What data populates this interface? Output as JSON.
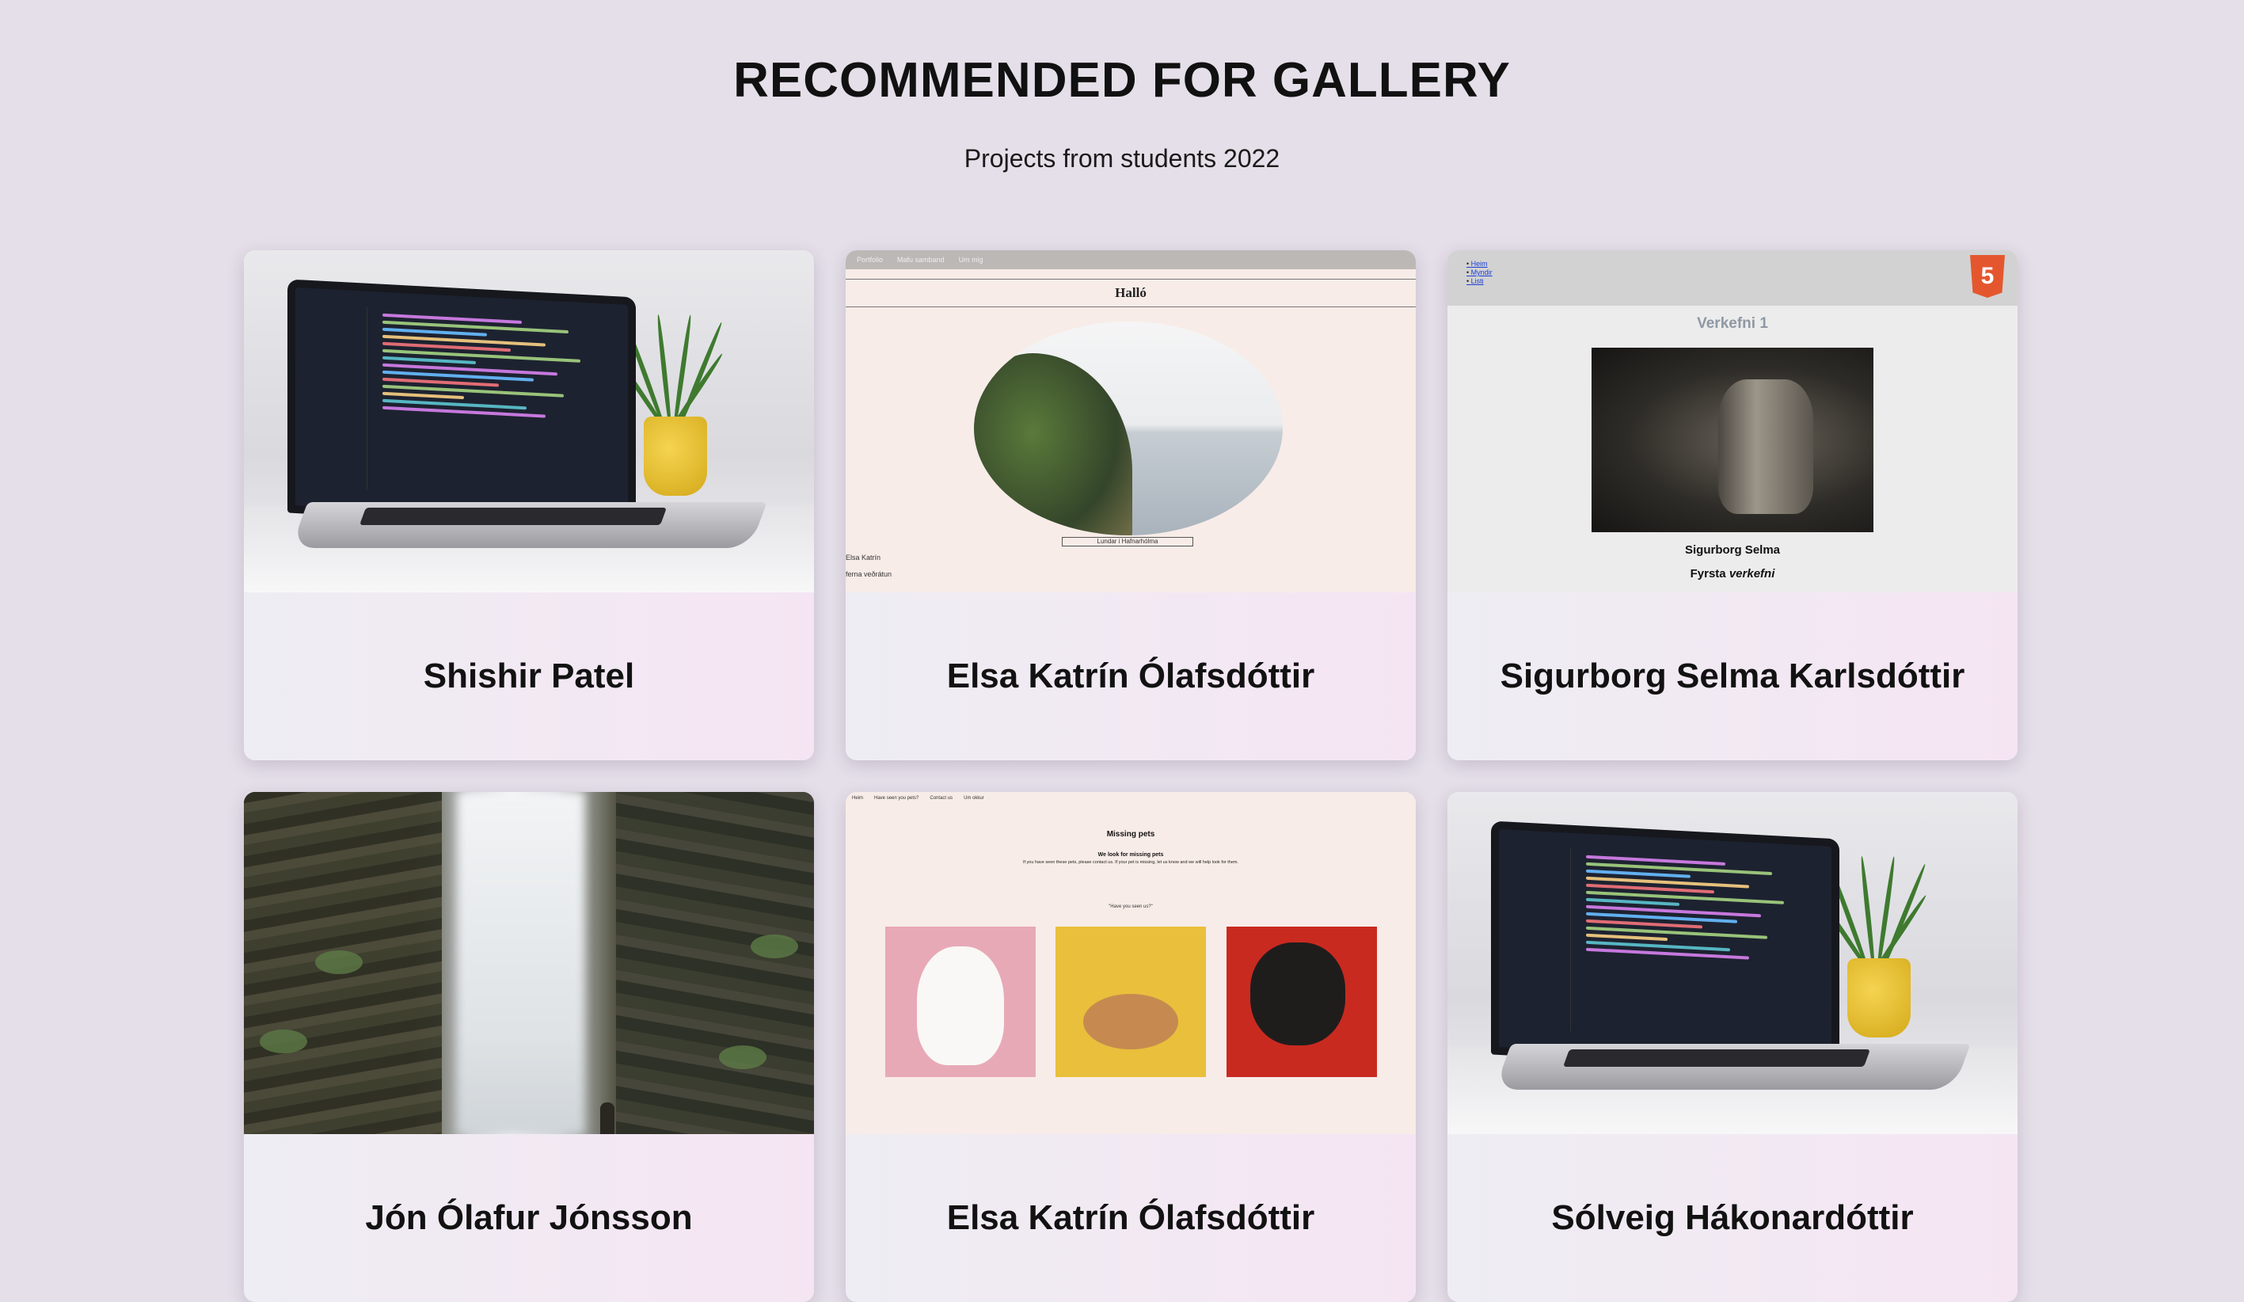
{
  "header": {
    "title": "RECOMMENDED FOR GALLERY",
    "subtitle": "Projects from students 2022"
  },
  "cards": [
    {
      "name": "Shishir Patel",
      "thumbnail": "laptop-with-code"
    },
    {
      "name": "Elsa Katrín Ólafsdóttir",
      "thumbnail": "hallo-website",
      "preview": {
        "nav": [
          "Portfolio",
          "Mafu samband",
          "Um mig"
        ],
        "title": "Halló",
        "caption": "Lundar i Hafnarhólma",
        "line1": "Elsa Katrín",
        "line2": "ferna veðrátun"
      }
    },
    {
      "name": "Sigurborg Selma Karlsdóttir",
      "thumbnail": "verkefni-website",
      "preview": {
        "links": [
          "Heim",
          "Myndir",
          "Listi"
        ],
        "heading": "Verkefni 1",
        "name": "Sigurborg Selma",
        "sub_prefix": "Fyrsta",
        "sub_em": "verkefni"
      }
    },
    {
      "name": "Jón Ólafur Jónsson",
      "thumbnail": "waterfall-photo"
    },
    {
      "name": "Elsa Katrín Ólafsdóttir",
      "thumbnail": "missing-pets-website",
      "preview": {
        "nav": [
          "Heim",
          "Have seen you pets?",
          "Contact us",
          "Um okkur"
        ],
        "heading": "Missing pets",
        "subheading": "We look for missing pets",
        "text": "If you have seen these pets, please contact us. If your pet is missing, let us know and we will help look for them.",
        "quote": "\"Have you seen us?\""
      }
    },
    {
      "name": "Sólveig Hákonardóttir",
      "thumbnail": "laptop-with-code"
    }
  ],
  "colors": {
    "background": "#e5dfe9",
    "card_start": "#eeedf3",
    "card_end": "#f5e5f3"
  }
}
